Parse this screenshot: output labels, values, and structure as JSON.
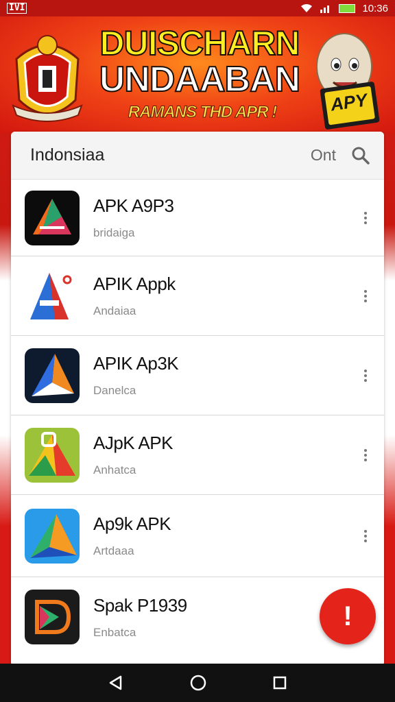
{
  "status": {
    "left": "IVI",
    "time": "10:36"
  },
  "banner": {
    "title_line1": "DUISCHARN",
    "title_line2": "UNDAABAN",
    "subtitle": "RAMANS THD APR !",
    "mascot_badge": "APY"
  },
  "search": {
    "title": "Indonsiaa",
    "option": "Ont"
  },
  "apps": [
    {
      "name": "APK A9P3",
      "sub": "bridaiga"
    },
    {
      "name": "APIK Appk",
      "sub": "Andaiaa"
    },
    {
      "name": "APIK Ap3K",
      "sub": "Danelca"
    },
    {
      "name": "AJpK APK",
      "sub": "Anhatca"
    },
    {
      "name": "Ap9k APK",
      "sub": "Artdaaa"
    },
    {
      "name": "Spak P1939",
      "sub": "Enbatca"
    }
  ],
  "fab": {
    "mark": "!"
  },
  "colors": {
    "brand_red": "#d81f16",
    "fab_red": "#e4231b",
    "banner_yellow": "#ffee22"
  }
}
